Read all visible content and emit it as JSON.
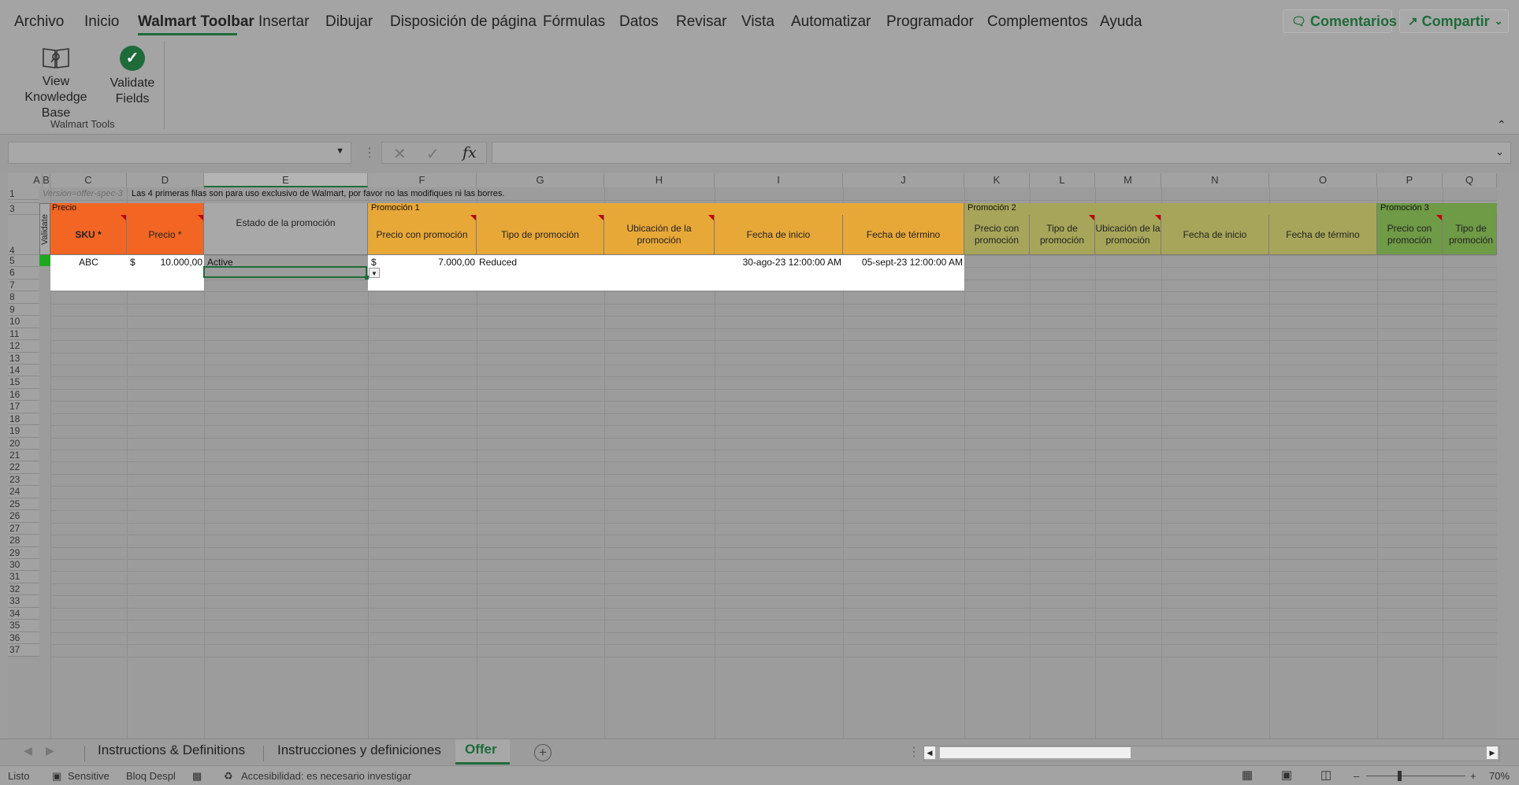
{
  "ribbon_tabs": [
    "Archivo",
    "Inicio",
    "Walmart Toolbar",
    "Insertar",
    "Dibujar",
    "Disposición de página",
    "Fórmulas",
    "Datos",
    "Revisar",
    "Vista",
    "Automatizar",
    "Programador",
    "Complementos",
    "Ayuda"
  ],
  "active_tab": "Walmart Toolbar",
  "comments_label": "Comentarios",
  "share_label": "Compartir",
  "tools": {
    "view_kb": "View\nKnowledge Base",
    "validate": "Validate\nFields",
    "group_label": "Walmart Tools"
  },
  "formula": {
    "name_box": "",
    "content": ""
  },
  "columns": [
    "A",
    "B",
    "C",
    "D",
    "E",
    "F",
    "G",
    "H",
    "I",
    "J",
    "K",
    "L",
    "M",
    "N",
    "O",
    "P",
    "Q"
  ],
  "rows": [
    "1",
    "2",
    "3",
    "4",
    "5",
    "6",
    "7",
    "8",
    "9",
    "10",
    "11",
    "12",
    "13",
    "14",
    "15",
    "16",
    "17",
    "18",
    "19",
    "20",
    "21",
    "22",
    "23",
    "24",
    "25",
    "26",
    "27",
    "28",
    "29",
    "30",
    "31",
    "32",
    "33",
    "34",
    "35",
    "36",
    "37"
  ],
  "sheet": {
    "version_note": "Version=offer-spec-3",
    "info_note": "Las 4 primeras filas son para uso exclusivo de Walmart, por favor no las modifiques ni las borres.",
    "validate_label": "Validate",
    "group_precio": "Precio",
    "group_promo1": "Promoción 1",
    "group_promo2": "Promoción 2",
    "group_promo3": "Promoción 3",
    "hdr_sku": "SKU *",
    "hdr_precio": "Precio *",
    "hdr_estado": "Estado de la promoción",
    "hdr_p1_precio": "Precio con promoción",
    "hdr_p1_tipo": "Tipo de promoción",
    "hdr_p1_ubic": "Ubicación de la promoción",
    "hdr_p1_inicio": "Fecha de inicio",
    "hdr_p1_termino": "Fecha de término",
    "hdr_p2_precio": "Precio con promoción",
    "hdr_p2_tipo": "Tipo de promoción",
    "hdr_p2_ubic": "Ubicación de la promoción",
    "hdr_p2_inicio": "Fecha de inicio",
    "hdr_p2_termino": "Fecha de término",
    "hdr_p3_precio": "Precio con promoción",
    "hdr_p3_tipo": "Tipo de promoción",
    "row5": {
      "sku": "ABC",
      "precio_sym": "$",
      "precio": "10.000,00",
      "estado": "Active",
      "p1_sym": "$",
      "p1_precio": "7.000,00",
      "p1_tipo": "Reduced",
      "p1_inicio": "30-ago-23 12:00:00 AM",
      "p1_termino": "05-sept-23 12:00:00 AM"
    }
  },
  "sheet_tabs": [
    "Instructions & Definitions",
    "Instrucciones y definiciones",
    "Offer"
  ],
  "active_sheet": "Offer",
  "status": {
    "ready": "Listo",
    "sensitivity": "Sensitive",
    "scroll_lock": "Bloq Despl",
    "accessibility": "Accesibilidad: es necesario investigar",
    "zoom": "70%"
  },
  "colors": {
    "orange": "#f26522",
    "amber": "#e8a838",
    "olive": "#a7a55a",
    "green": "#6f9a46",
    "accent": "#1e6b3a"
  }
}
